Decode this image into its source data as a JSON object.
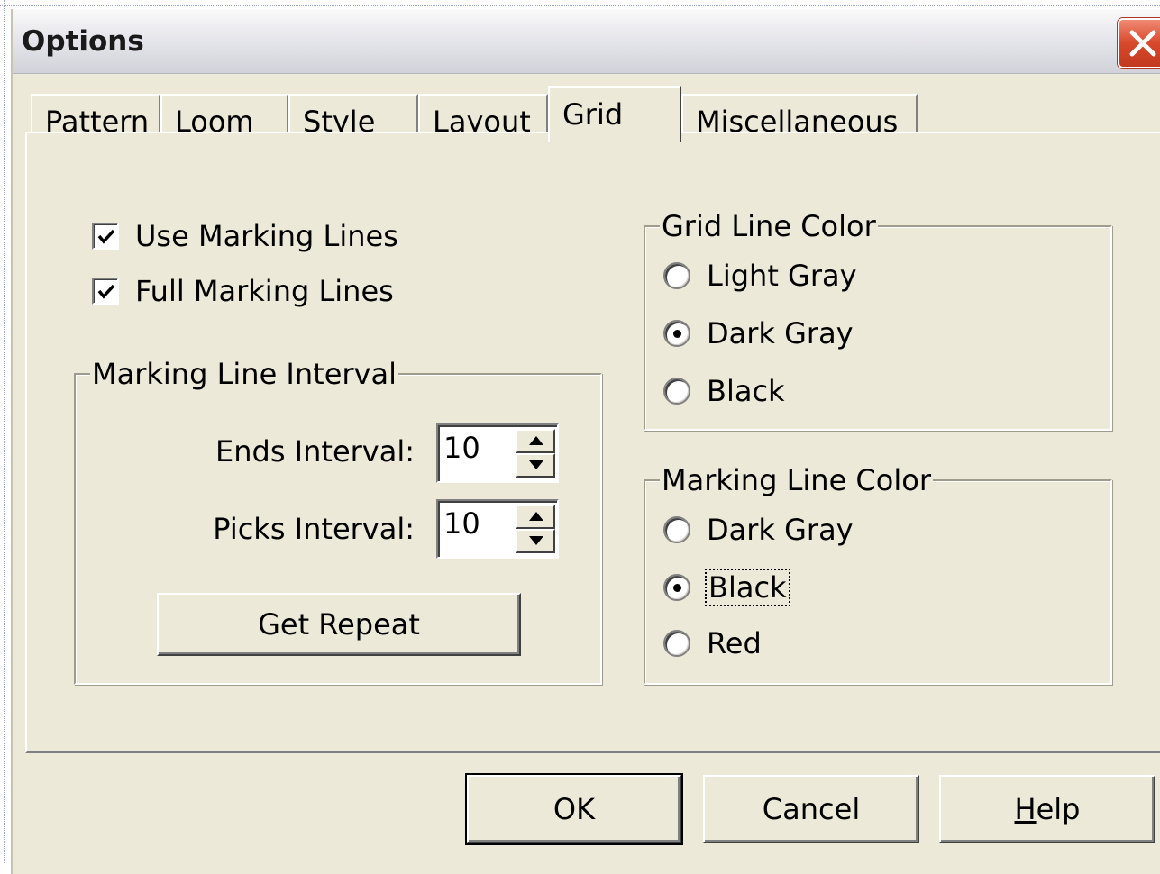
{
  "window": {
    "title": "Options",
    "close_icon": "close-icon"
  },
  "tabs": [
    {
      "label": "Pattern",
      "active": false
    },
    {
      "label": "Loom",
      "active": false
    },
    {
      "label": "Style",
      "active": false
    },
    {
      "label": "Layout",
      "active": false
    },
    {
      "label": "Grid",
      "active": true
    },
    {
      "label": "Miscellaneous",
      "active": false
    }
  ],
  "grid_tab": {
    "use_marking_lines": {
      "label": "Use Marking Lines",
      "checked": true
    },
    "full_marking_lines": {
      "label": "Full Marking Lines",
      "checked": true
    },
    "marking_line_interval": {
      "title": "Marking Line Interval",
      "ends_interval": {
        "label": "Ends Interval:",
        "value": "10"
      },
      "picks_interval": {
        "label": "Picks Interval:",
        "value": "10"
      },
      "get_repeat_label": "Get Repeat"
    },
    "grid_line_color": {
      "title": "Grid Line Color",
      "options": [
        {
          "label": "Light Gray",
          "selected": false
        },
        {
          "label": "Dark Gray",
          "selected": true
        },
        {
          "label": "Black",
          "selected": false
        }
      ]
    },
    "marking_line_color": {
      "title": "Marking Line Color",
      "options": [
        {
          "label": "Dark Gray",
          "selected": false
        },
        {
          "label": "Black",
          "selected": true
        },
        {
          "label": "Red",
          "selected": false
        }
      ]
    }
  },
  "footer": {
    "ok_label": "OK",
    "cancel_label": "Cancel",
    "help_mnemonic": "H",
    "help_rest": "elp"
  },
  "colors": {
    "dialog_bg": "#ece9d8",
    "close_button": "#d8482c"
  }
}
